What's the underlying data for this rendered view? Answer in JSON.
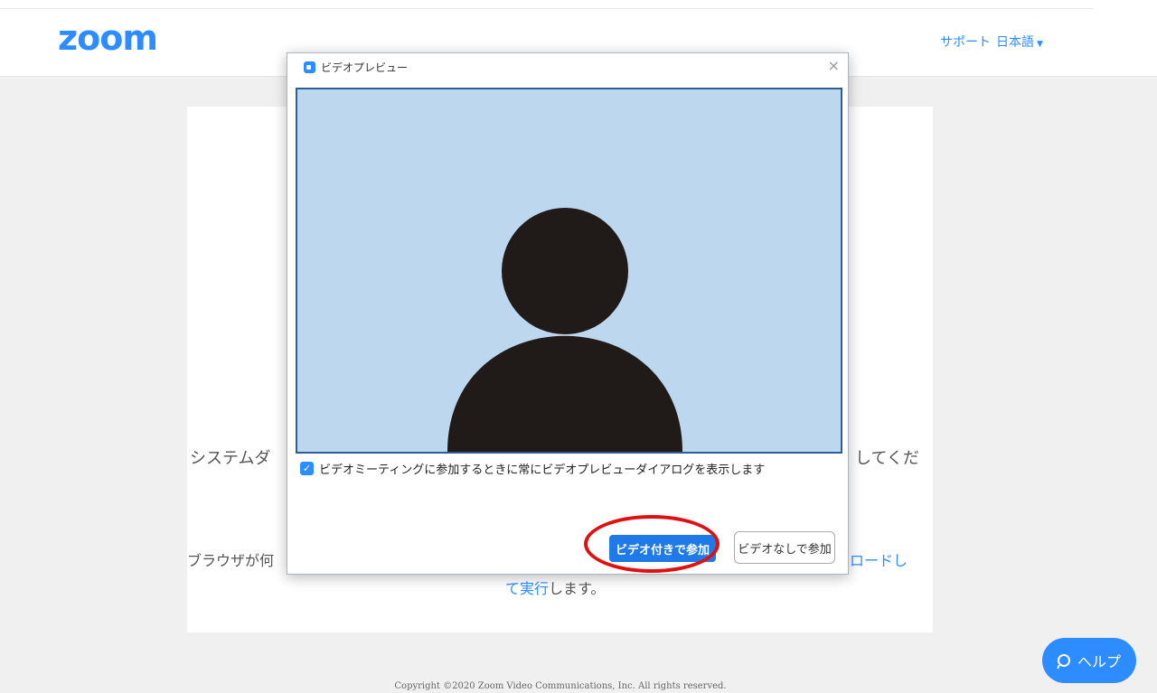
{
  "header": {
    "logo": "zoom",
    "support": "サポート",
    "language": "日本語",
    "language_caret": "▼"
  },
  "background": {
    "line1_left": "システムダ",
    "line1_right": "してくだ",
    "line2_left": "ブラウザが何",
    "line2_right": "ンロードし",
    "line3_link": "て実行",
    "line3_rest": "します。",
    "copyright": "Copyright ©2020 Zoom Video Communications, Inc. All rights reserved."
  },
  "dialog": {
    "title": "ビデオプレビュー",
    "close": "×",
    "checkbox_label": "ビデオミーティングに参加するときに常にビデオプレビューダイアログを表示します",
    "checkbox_checked": true,
    "join_with_video": "ビデオ付きで参加",
    "join_without_video": "ビデオなしで参加"
  },
  "help": {
    "label": "ヘルプ"
  },
  "colors": {
    "accent": "#2d8cff",
    "preview_bg": "#bdd7ee",
    "preview_border": "#2e5d9a",
    "highlight": "#e01010",
    "avatar": "#201a19"
  },
  "icons": {
    "camera": "video-camera-icon",
    "help": "chat-bubble-icon"
  }
}
